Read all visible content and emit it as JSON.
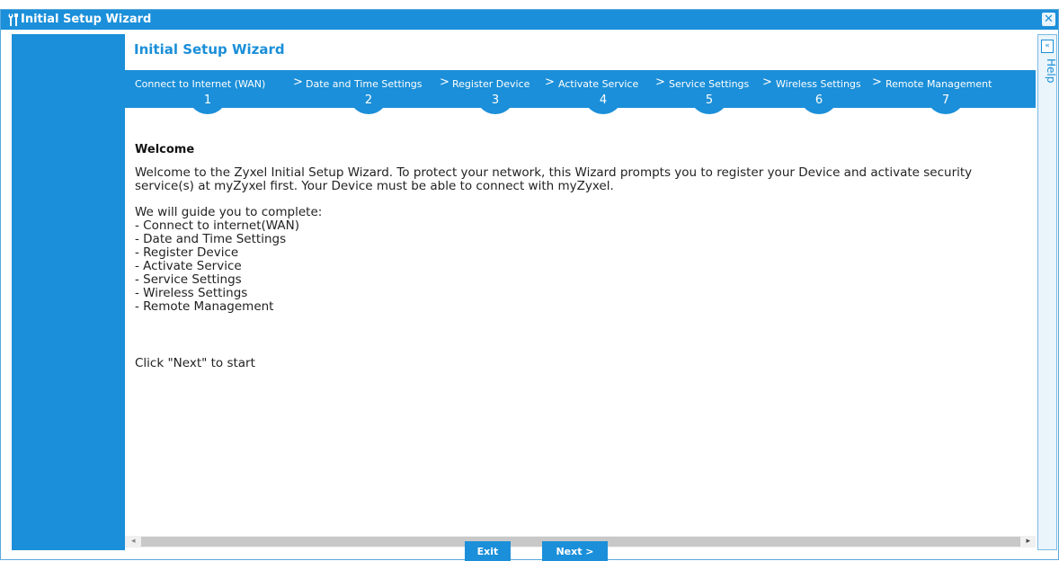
{
  "window": {
    "title": "Initial Setup Wizard",
    "icon": "tools-icon",
    "close_icon": "close-icon",
    "close_label": "✕"
  },
  "content": {
    "title": "Initial Setup Wizard"
  },
  "steps": [
    {
      "label": "Connect to Internet (WAN)",
      "number": "1"
    },
    {
      "label": "Date and Time Settings",
      "number": "2"
    },
    {
      "label": "Register Device",
      "number": "3"
    },
    {
      "label": "Activate Service",
      "number": "4"
    },
    {
      "label": "Service Settings",
      "number": "5"
    },
    {
      "label": "Wireless Settings",
      "number": "6"
    },
    {
      "label": "Remote Management",
      "number": "7"
    }
  ],
  "step_separator": ">",
  "welcome": {
    "title": "Welcome",
    "text": "Welcome to the Zyxel Initial Setup Wizard. To protect your network, this Wizard prompts you to register your Device and activate security service(s) at myZyxel first. Your Device must be able to connect with myZyxel.",
    "guide_intro": "We will guide you to complete:",
    "guide_items": [
      "- Connect to internet(WAN)",
      "- Date and Time Settings",
      "- Register Device",
      "- Activate Service",
      "- Service Settings",
      "- Wireless Settings",
      "- Remote Management"
    ],
    "click_text": "Click \"Next\" to start"
  },
  "help": {
    "label": "Help",
    "collapse_label": "«"
  },
  "scrollbar": {
    "left_arrow": "◂",
    "right_arrow": "▸"
  },
  "buttons": {
    "exit_label": "Exit",
    "next_label": "Next >"
  },
  "colors": {
    "accent": "#1b8fd9",
    "sidebar": "#1b8fd9",
    "help_panel": "#e9f4fb"
  }
}
